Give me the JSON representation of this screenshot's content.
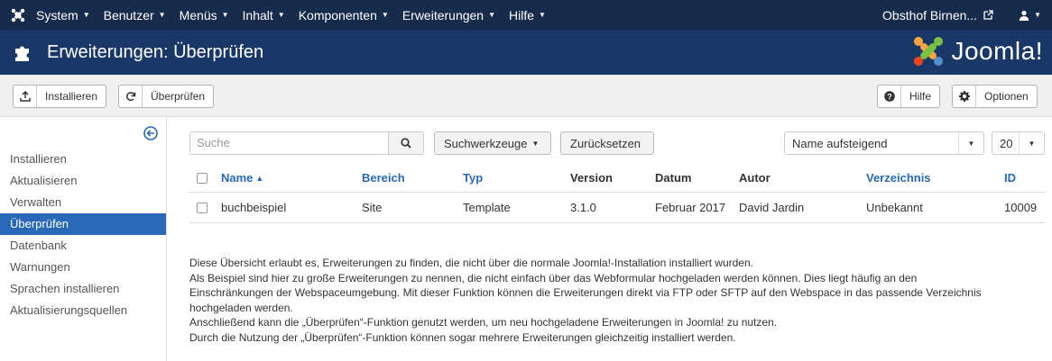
{
  "navbar": {
    "items": [
      {
        "label": "System"
      },
      {
        "label": "Benutzer"
      },
      {
        "label": "Menüs"
      },
      {
        "label": "Inhalt"
      },
      {
        "label": "Komponenten"
      },
      {
        "label": "Erweiterungen"
      },
      {
        "label": "Hilfe"
      }
    ],
    "site_label": "Obsthof Birnen...",
    "user_icon": "user-icon",
    "external_icon": "external-link-icon"
  },
  "header": {
    "title": "Erweiterungen: Überprüfen",
    "icon": "puzzle-icon",
    "brand": "Joomla!"
  },
  "toolbar": {
    "install_label": "Installieren",
    "discover_label": "Überprüfen",
    "help_label": "Hilfe",
    "options_label": "Optionen"
  },
  "sidebar": {
    "items": [
      {
        "label": "Installieren",
        "active": false
      },
      {
        "label": "Aktualisieren",
        "active": false
      },
      {
        "label": "Verwalten",
        "active": false
      },
      {
        "label": "Überprüfen",
        "active": true
      },
      {
        "label": "Datenbank",
        "active": false
      },
      {
        "label": "Warnungen",
        "active": false
      },
      {
        "label": "Sprachen installieren",
        "active": false
      },
      {
        "label": "Aktualisierungsquellen",
        "active": false
      }
    ]
  },
  "filters": {
    "search_placeholder": "Suche",
    "search_tools_label": "Suchwerkzeuge",
    "reset_label": "Zurücksetzen",
    "ordering_value": "Name aufsteigend",
    "limit_value": "20"
  },
  "table": {
    "headers": {
      "name": "Name",
      "client": "Bereich",
      "type": "Typ",
      "version": "Version",
      "date": "Datum",
      "author": "Autor",
      "folder": "Verzeichnis",
      "id": "ID"
    },
    "rows": [
      {
        "name": "buchbeispiel",
        "client": "Site",
        "type": "Template",
        "version": "3.1.0",
        "date": "Februar 2017",
        "author": "David Jardin",
        "folder": "Unbekannt",
        "id": "10009"
      }
    ]
  },
  "info": {
    "lines": [
      "Diese Übersicht erlaubt es, Erweiterungen zu finden, die nicht über die normale Joomla!-Installation installiert wurden.",
      "Als Beispiel sind hier zu große Erweiterungen zu nennen, die nicht einfach über das Webformular hochgeladen werden können. Dies liegt häufig an den Einschränkungen der Webspaceumgebung. Mit dieser Funktion können die Erweiterungen direkt via FTP oder SFTP auf den Webspace in das passende Verzeichnis hochgeladen werden.",
      "Anschließend kann die „Überprüfen“-Funktion genutzt werden, um neu hochgeladene Erweiterungen in Joomla! zu nutzen.",
      "Durch die Nutzung der „Überprüfen“-Funktion können sogar mehrere Erweiterungen gleichzeitig installiert werden."
    ]
  },
  "colors": {
    "navbar_bg": "#172b4d",
    "header_bg": "#1a3867",
    "accent": "#2a69b8"
  }
}
